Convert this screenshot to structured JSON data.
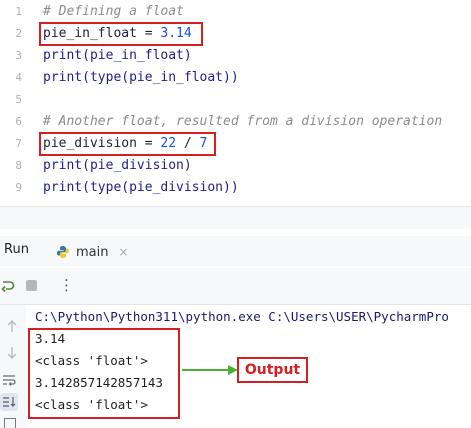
{
  "editor": {
    "line_numbers": [
      "1",
      "2",
      "3",
      "4",
      "5",
      "6",
      "7",
      "8",
      "9"
    ],
    "lines": [
      {
        "type": "comment",
        "text": "# Defining a float"
      },
      {
        "type": "assign",
        "var": "pie_in_float",
        "op": " = ",
        "value": "3.14"
      },
      {
        "type": "print",
        "text": "print(pie_in_float)"
      },
      {
        "type": "print",
        "text": "print(type(pie_in_float))"
      },
      {
        "type": "blank",
        "text": ""
      },
      {
        "type": "comment",
        "text": "# Another float, resulted from a division operation"
      },
      {
        "type": "assign2",
        "var": "pie_division",
        "op": " = ",
        "v1": "22",
        "div": " / ",
        "v2": "7"
      },
      {
        "type": "print",
        "text": "print(pie_division)"
      },
      {
        "type": "print",
        "text": "print(type(pie_division))"
      }
    ]
  },
  "run_panel": {
    "label": "Run",
    "tab_label": "main",
    "tab_close": "×",
    "more_glyph": "⋮"
  },
  "console": {
    "command": "C:\\Python\\Python311\\python.exe C:\\Users\\USER\\PycharmPro",
    "output_lines": [
      "3.14",
      "<class 'float'>",
      "3.142857142857143",
      "<class 'float'>"
    ]
  },
  "annotation": {
    "label": "Output"
  },
  "colors": {
    "highlight_border": "#d42020",
    "arrow": "#4cae32",
    "number": "#1750eb",
    "comment": "#8c8c8c"
  }
}
